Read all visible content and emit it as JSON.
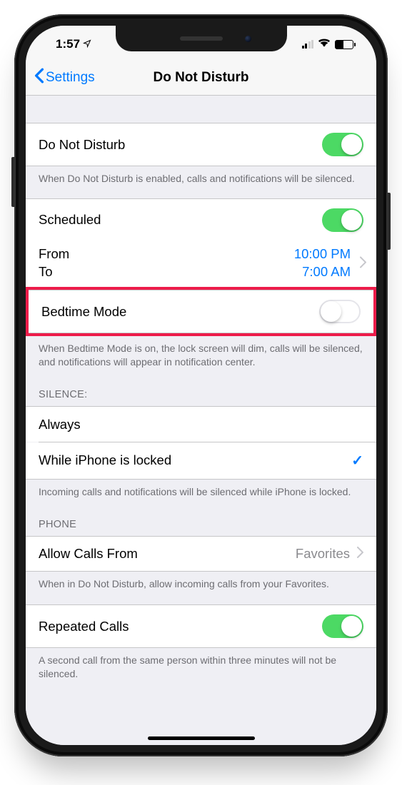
{
  "status": {
    "time": "1:57"
  },
  "nav": {
    "back": "Settings",
    "title": "Do Not Disturb"
  },
  "dnd": {
    "label": "Do Not Disturb",
    "on": true,
    "footer": "When Do Not Disturb is enabled, calls and notifications will be silenced."
  },
  "scheduled": {
    "label": "Scheduled",
    "on": true,
    "from_label": "From",
    "to_label": "To",
    "from_time": "10:00 PM",
    "to_time": "7:00 AM"
  },
  "bedtime": {
    "label": "Bedtime Mode",
    "on": false,
    "footer": "When Bedtime Mode is on, the lock screen will dim, calls will be silenced, and notifications will appear in notification center."
  },
  "silence": {
    "header": "SILENCE:",
    "always": "Always",
    "locked": "While iPhone is locked",
    "selected": "locked",
    "footer": "Incoming calls and notifications will be silenced while iPhone is locked."
  },
  "phone": {
    "header": "PHONE",
    "allow_label": "Allow Calls From",
    "allow_value": "Favorites",
    "footer": "When in Do Not Disturb, allow incoming calls from your Favorites."
  },
  "repeated": {
    "label": "Repeated Calls",
    "on": true,
    "footer": "A second call from the same person within three minutes will not be silenced."
  }
}
